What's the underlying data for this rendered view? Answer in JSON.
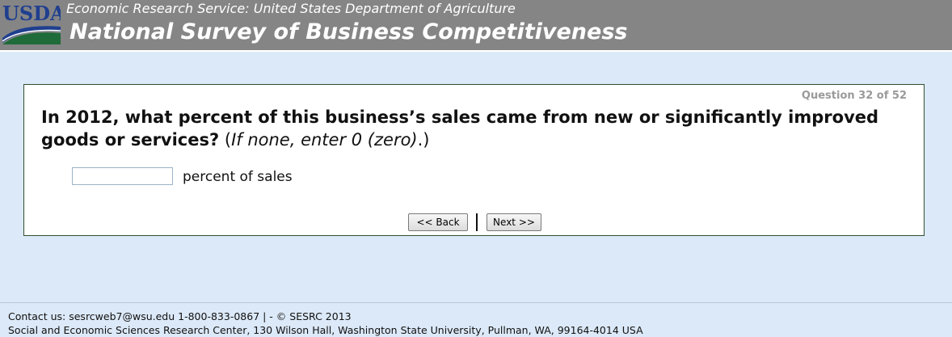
{
  "header": {
    "logo_text": "USDA",
    "agency": "Economic Research Service: United States Department of Agriculture",
    "title": "National Survey of Business Competitiveness",
    "colors": {
      "bar": "#858585",
      "logo_blue": "#1f3f8f",
      "logo_green": "#1f6b3a"
    }
  },
  "question": {
    "counter": "Question 32 of 52",
    "text_bold": "In 2012, what percent of this business’s sales came from new or significantly improved goods or services?",
    "instruction_open": "(",
    "instruction_italic": "If none, enter 0 (zero)",
    "instruction_close": ".)",
    "input_value": "",
    "input_suffix": "percent of sales"
  },
  "nav": {
    "back_label": "<< Back",
    "next_label": "Next >>"
  },
  "footer": {
    "line1": "Contact us: sesrcweb7@wsu.edu 1-800-833-0867 | - © SESRC 2013",
    "line2": "Social and Economic Sciences Research Center, 130 Wilson Hall, Washington State University, Pullman, WA, 99164-4014 USA"
  },
  "colors": {
    "page_bg": "#dce9f8",
    "panel_border": "#2f4f2f"
  }
}
